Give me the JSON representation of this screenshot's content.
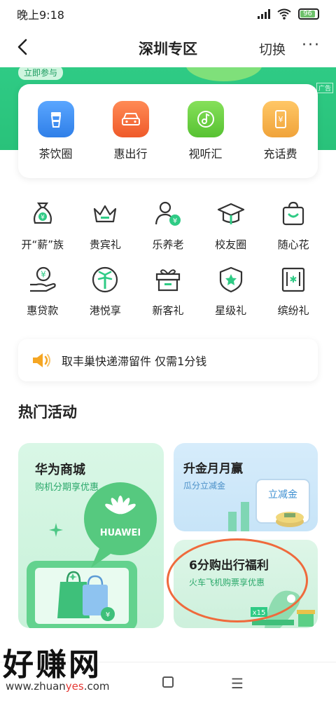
{
  "status": {
    "time": "晚上9:18",
    "battery": "96"
  },
  "header": {
    "title": "深圳专区",
    "switch": "切换",
    "more": "···"
  },
  "banner": {
    "join": "立即参与",
    "ad": "广告"
  },
  "top_cards": [
    {
      "label": "茶饮圈",
      "icon": "cup-icon",
      "color": "#3b8cf0"
    },
    {
      "label": "惠出行",
      "icon": "car-icon",
      "color": "#f36b3b"
    },
    {
      "label": "视听汇",
      "icon": "music-icon",
      "color": "#6ccf3c"
    },
    {
      "label": "充话费",
      "icon": "phone-yen-icon",
      "color": "#f5b243"
    }
  ],
  "grid_row1": [
    {
      "label": "开“薪”族",
      "icon": "money-bag-icon"
    },
    {
      "label": "贵宾礼",
      "icon": "crown-icon"
    },
    {
      "label": "乐养老",
      "icon": "elder-yen-icon"
    },
    {
      "label": "校友圈",
      "icon": "graduation-cap-icon"
    },
    {
      "label": "随心花",
      "icon": "shopping-bag-icon"
    }
  ],
  "grid_row2": [
    {
      "label": "惠贷款",
      "icon": "hand-yen-icon"
    },
    {
      "label": "港悦享",
      "icon": "palm-tree-icon"
    },
    {
      "label": "新客礼",
      "icon": "gift-box-icon"
    },
    {
      "label": "星级礼",
      "icon": "star-shield-icon"
    },
    {
      "label": "缤纷礼",
      "icon": "present-icon"
    }
  ],
  "notice": {
    "text": "取丰巢快递滞留件 仅需1分钱",
    "icon": "speaker-icon"
  },
  "section": {
    "title": "热门活动"
  },
  "activities": {
    "huawei": {
      "title": "华为商城",
      "subtitle": "购机分期享优惠",
      "logo": "HUAWEI"
    },
    "shengjin": {
      "title": "升金月月赢",
      "subtitle": "瓜分立减金",
      "card_text": "立减金"
    },
    "chuxing": {
      "title": "6分购出行福利",
      "subtitle": "火车飞机购票享优惠",
      "badge": "x15"
    }
  },
  "watermark": {
    "big": "好赚网",
    "url_pre": "www.zhuan",
    "url_mid": "yes",
    "url_post": ".com"
  },
  "colors": {
    "green": "#2fcb85",
    "accent_orange": "#ef6a3c"
  }
}
